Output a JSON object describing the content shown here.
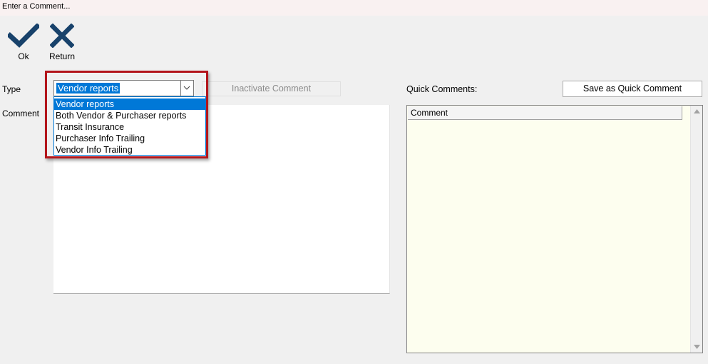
{
  "window": {
    "title": "Enter a Comment..."
  },
  "toolbar": {
    "ok_label": "Ok",
    "return_label": "Return",
    "ok_icon": "checkmark-icon",
    "return_icon": "x-icon",
    "icon_color": "#18426b"
  },
  "form": {
    "type_label": "Type",
    "comment_label": "Comment",
    "type_selected": "Vendor reports",
    "type_options": [
      "Vendor reports",
      "Both Vendor & Purchaser reports",
      "Transit Insurance",
      "Purchaser Info Trailing",
      "Vendor Info Trailing"
    ],
    "inactivate_label": "Inactivate Comment",
    "comment_text": ""
  },
  "quick": {
    "label": "Quick Comments:",
    "save_label": "Save as Quick Comment",
    "column_header": "Comment"
  },
  "colors": {
    "selection": "#0078d7",
    "highlight_border": "#b3151b",
    "grid_background": "#fdfeef"
  }
}
